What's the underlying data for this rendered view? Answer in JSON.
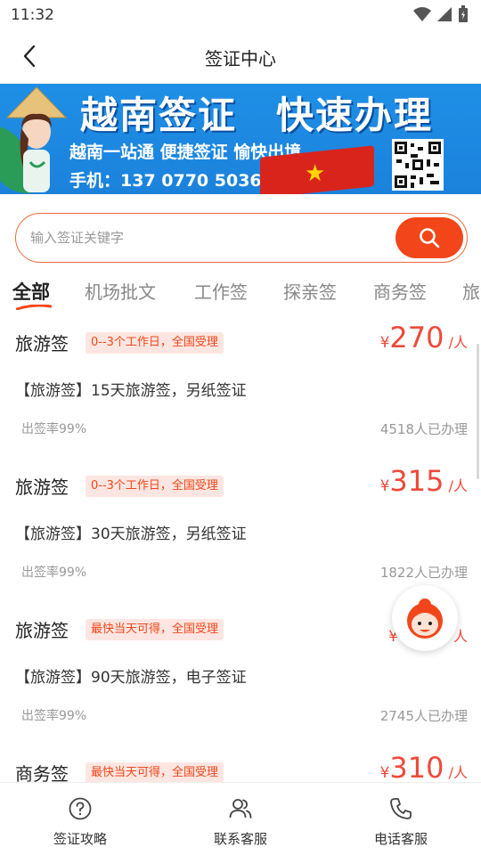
{
  "status_bar": {
    "time": "11:32",
    "icons": [
      "wifi-icon",
      "signal-icon",
      "battery-icon"
    ]
  },
  "nav": {
    "title": "签证中心",
    "back_icon": "chevron-left-icon"
  },
  "banner": {
    "title": "越南签证　快速办理",
    "line1": "越南一站通 便捷签证 愉快出境",
    "line2": "手机：137 0770 5036"
  },
  "search": {
    "placeholder": "输入签证关键字",
    "value": "",
    "icon": "search-icon"
  },
  "tabs": [
    {
      "label": "全部",
      "active": true
    },
    {
      "label": "机场批文",
      "active": false
    },
    {
      "label": "工作签",
      "active": false
    },
    {
      "label": "探亲签",
      "active": false
    },
    {
      "label": "商务签",
      "active": false
    },
    {
      "label": "旅游签",
      "active": false
    }
  ],
  "items": [
    {
      "title": "旅游签",
      "tag": "0--3个工作日，全国受理",
      "price_symbol": "¥",
      "price": "270",
      "unit": "/人",
      "desc": "【旅游签】15天旅游签，另纸签证",
      "rate": "出签率99%",
      "count": "4518人已办理"
    },
    {
      "title": "旅游签",
      "tag": "0--3个工作日，全国受理",
      "price_symbol": "¥",
      "price": "315",
      "unit": "/人",
      "desc": "【旅游签】30天旅游签，另纸签证",
      "rate": "出签率99%",
      "count": "1822人已办理"
    },
    {
      "title": "旅游签",
      "tag": "最快当天可得，全国受理",
      "price_symbol": "¥",
      "price": "",
      "unit": "人",
      "desc": "【旅游签】90天旅游签，电子签证",
      "rate": "出签率99%",
      "count": "2745人已办理"
    },
    {
      "title": "商务签",
      "tag": "最快当天可得，全国受理",
      "price_symbol": "¥",
      "price": "310",
      "unit": "/人",
      "desc": "",
      "rate": "",
      "count": ""
    }
  ],
  "fab": {
    "icon": "customer-service-avatar-icon"
  },
  "bottom_bar": [
    {
      "label": "签证攻略",
      "icon": "help-circle-icon"
    },
    {
      "label": "联系客服",
      "icon": "contacts-icon"
    },
    {
      "label": "电话客服",
      "icon": "phone-icon"
    }
  ],
  "colors": {
    "accent": "#f2461a",
    "price": "#ef4a3a",
    "tag_bg": "#fde6e1",
    "banner_bg": "#1f8fe6"
  }
}
